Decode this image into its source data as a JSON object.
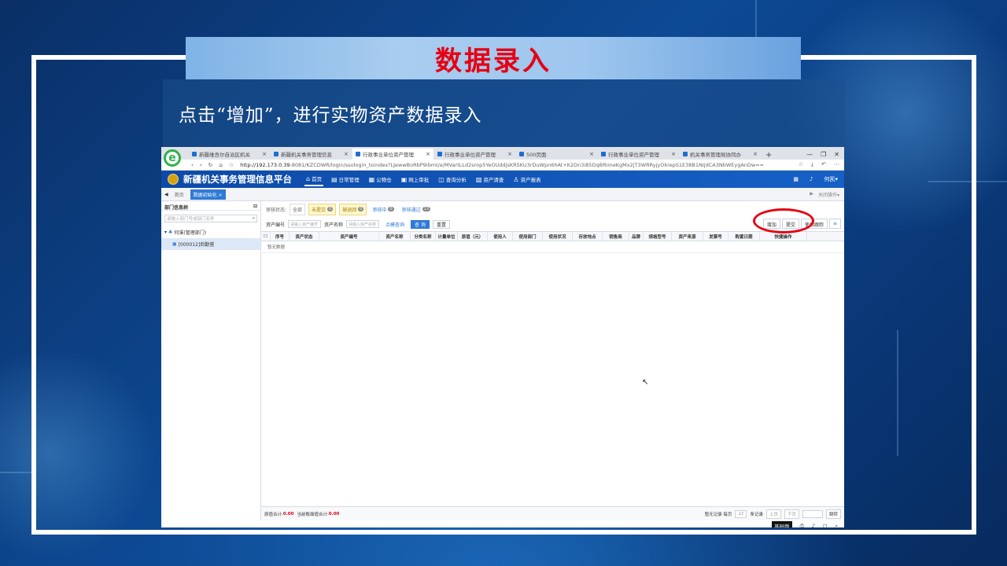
{
  "slide": {
    "title": "数据录入",
    "caption": "点击“增加”，进行实物资产数据录入"
  },
  "browser": {
    "tabs": [
      {
        "label": "新疆维吾尔自治区机关",
        "close": "×"
      },
      {
        "label": "新疆机关事务管理信息",
        "close": "×"
      },
      {
        "label": "行政事业单位资产管理",
        "close": "×"
      },
      {
        "label": "行政事业单位资产管理",
        "close": "×"
      },
      {
        "label": "500页面",
        "close": "×"
      },
      {
        "label": "行政事业单位资产管理",
        "close": "×"
      },
      {
        "label": "机关事务管理局协同办",
        "close": "×"
      }
    ],
    "new_tab": "+",
    "window_controls": [
      "—",
      "❐",
      "✕"
    ],
    "url_host": "http://192.173.0.39",
    "url_rest": ":8081/KZCDWR/login/ssologin_toindex?LJewwBoRbP9ibmt/e/MVartLLd2srop5YeOUddjsKRSKU3rDuWpn6hAt+K2Dn3i85DqBRimeKgMx2jT3WRRyjyOkrepS1E38B1NIjdCA3NbWEygAnDw==",
    "nav_buttons": [
      "‹",
      "›",
      "↻",
      "⌂",
      "☆"
    ],
    "addr_right": [
      "☆",
      "⤓",
      "↶",
      "⋯"
    ]
  },
  "app": {
    "title": "新疆机关事务管理信息平台",
    "nav": [
      {
        "icon": "⌂",
        "label": "首页"
      },
      {
        "icon": "▤",
        "label": "日常管理"
      },
      {
        "icon": "▦",
        "label": "公物仓"
      },
      {
        "icon": "▣",
        "label": "网上审批"
      },
      {
        "icon": "◫",
        "label": "查询分析"
      },
      {
        "icon": "▧",
        "label": "资产清查"
      },
      {
        "icon": "♙",
        "label": "资产报表"
      }
    ],
    "header_right": {
      "calendar": "▦",
      "bell": "♪",
      "user": "何凯▾"
    },
    "subtabs": [
      {
        "label": "首页"
      },
      {
        "label": "数据初始化 ×"
      }
    ],
    "subtab_ops": "关闭操作▾",
    "left_panel": {
      "header": "部门信息树",
      "search_placeholder": "请输入部门号或部门名称",
      "tree_root": "何溪(管理部门)",
      "tree_child": "[000012]后勤营"
    },
    "status_filter": {
      "label": "审核状态:",
      "all": "全部",
      "not_submitted": "未提交",
      "not_submitted_count": "0",
      "returned": "被退回",
      "returned_count": "0",
      "reviewing": "审核中",
      "reviewing_count": "0",
      "approved": "审核通过",
      "approved_count": "13"
    },
    "query": {
      "asset_no_label": "资产编号",
      "asset_no_placeholder": "请输入资产编号",
      "asset_name_label": "资产名称",
      "asset_name_placeholder": "请输入资产名称",
      "columns_btn": "点模查询",
      "search_btn": "查 询",
      "reset_btn": "重置"
    },
    "actions": [
      "增加",
      "提交",
      "使用跟踪",
      "≡"
    ],
    "columns": [
      "序号",
      "资产状态",
      "资产编号",
      "资产名称",
      "分类名称",
      "计量单位",
      "原值（元）",
      "使用人",
      "使用部门",
      "使用状况",
      "存放地点",
      "销售商",
      "品牌",
      "规格型号",
      "资产来源",
      "发票号",
      "购置日期",
      "快捷操作"
    ],
    "no_data": "暂无数据",
    "footer": {
      "original_total_label": "原值合计:",
      "original_total": "0.00",
      "current_total_label": "当前账面值合计:",
      "current_total": "0.00",
      "record_info": "暂无记录 每页",
      "page_size": "22",
      "records_suffix": "条记录",
      "prev": "上页",
      "next": "下页",
      "jump": "跳转"
    },
    "bottom_strip": [
      "基础版",
      "⎙",
      "♪",
      "◻",
      "⌕"
    ]
  }
}
